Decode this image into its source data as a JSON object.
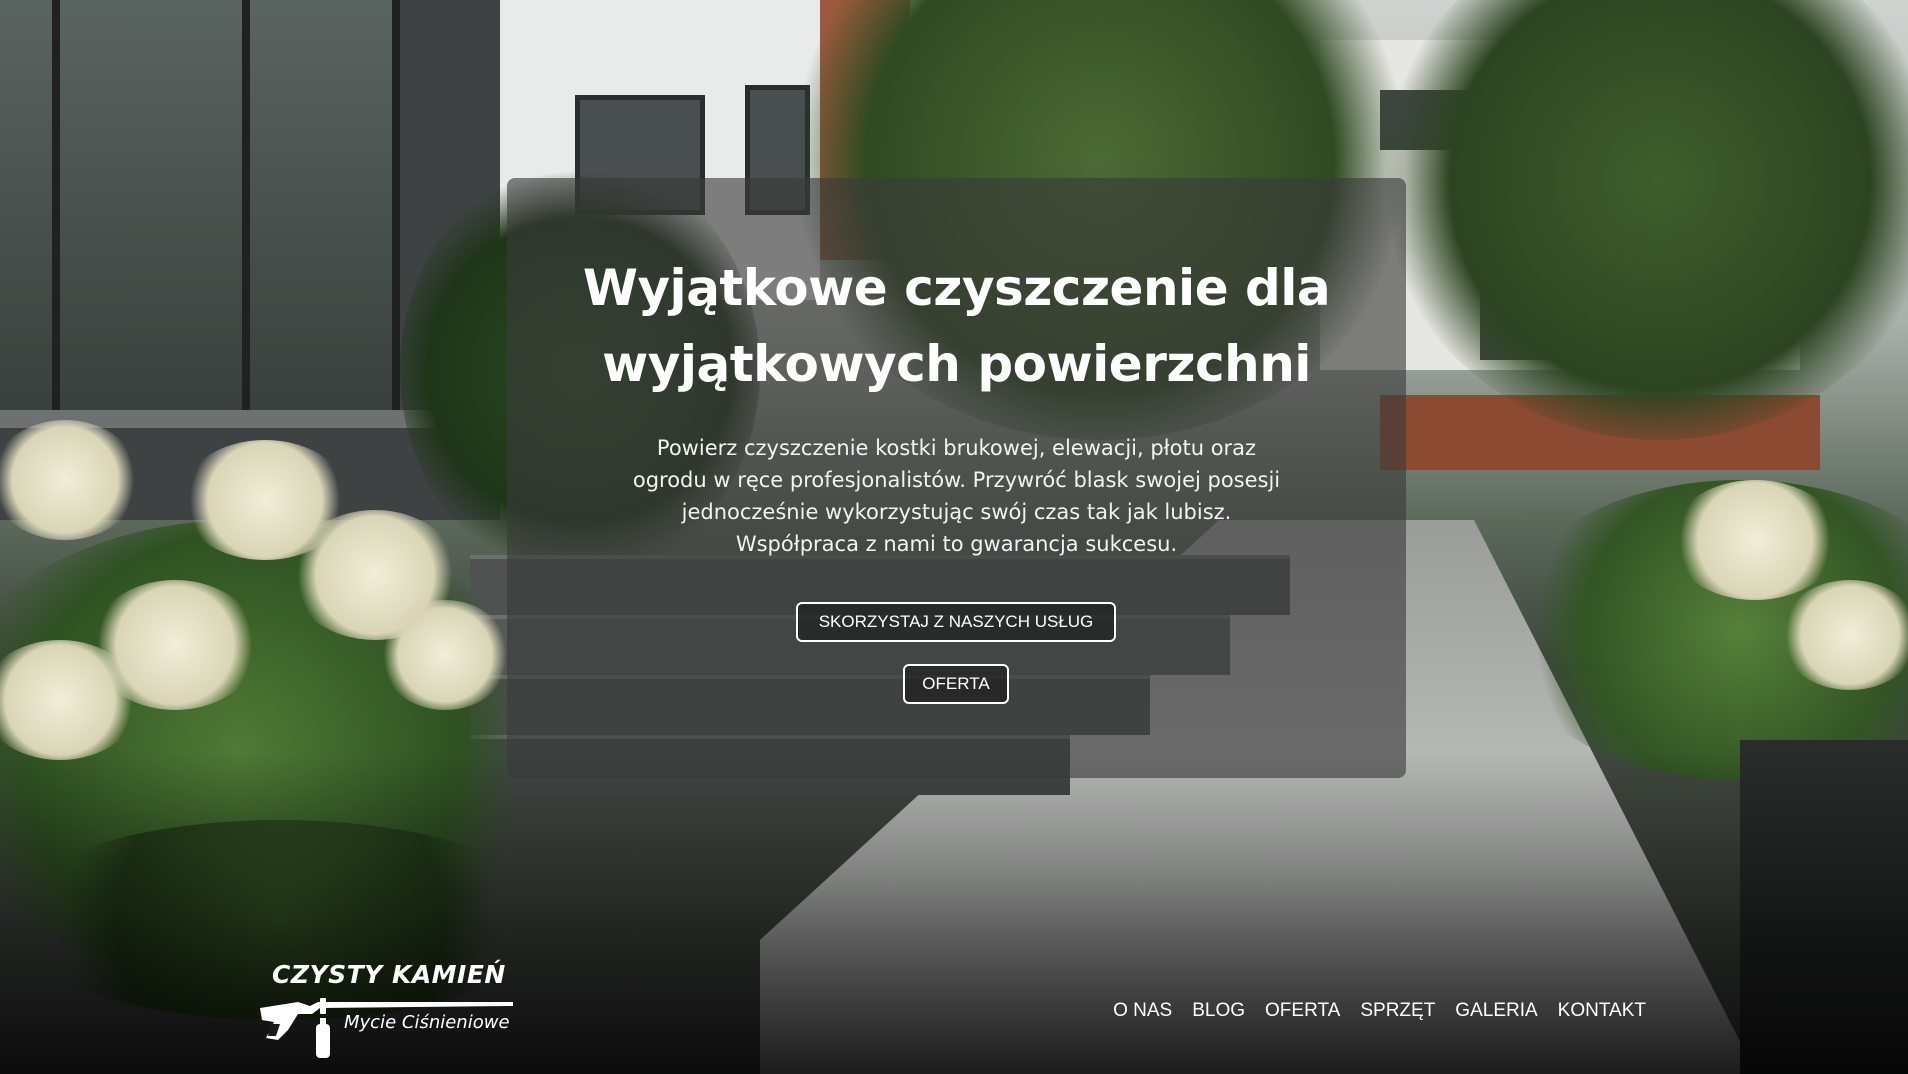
{
  "hero": {
    "title_line1": "Wyjątkowe czyszczenie dla",
    "title_line2": "wyjątkowych powierzchni",
    "text_line1": "Powierz czyszczenie kostki brukowej, elewacji, płotu oraz",
    "text_line2": "ogrodu w ręce profesjonalistów. Przywróć blask swojej posesji",
    "text_line3": "jednocześnie wykorzystując swój czas tak jak lubisz.",
    "text_line4": "Współpraca z nami to gwarancja sukcesu.",
    "primary_button": "SKORZYSTAJ Z NASZYCH USŁUG",
    "secondary_button": "OFERTA"
  },
  "logo": {
    "title": "CZYSTY KAMIEŃ",
    "subtitle": "Mycie Ciśnieniowe",
    "icon": "pressure-washer-icon"
  },
  "nav": {
    "items": [
      "O NAS",
      "BLOG",
      "OFERTA",
      "SPRZĘT",
      "GALERIA",
      "KONTAKT"
    ]
  },
  "colors": {
    "panel": "#3a3a3a",
    "text": "#ffffff"
  }
}
